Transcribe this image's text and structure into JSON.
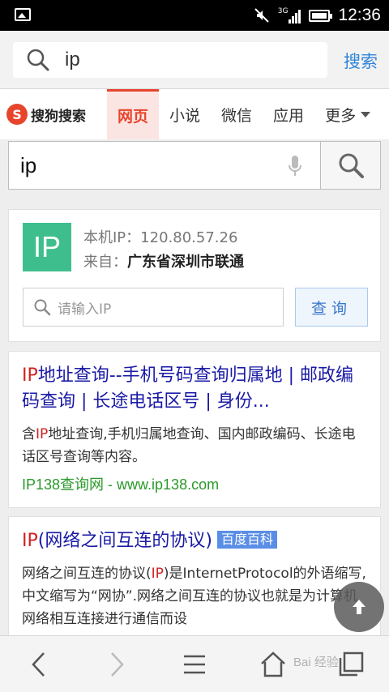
{
  "status_bar": {
    "time": "12:36",
    "network": "3G"
  },
  "url_bar": {
    "query": "ip",
    "search_label": "搜索"
  },
  "tabs": {
    "logo_mark": "S",
    "logo_text": "搜狗搜索",
    "items": [
      {
        "label": "网页",
        "active": true
      },
      {
        "label": "小说",
        "active": false
      },
      {
        "label": "微信",
        "active": false
      },
      {
        "label": "应用",
        "active": false
      },
      {
        "label": "更多",
        "active": false
      }
    ]
  },
  "search": {
    "value": "ip"
  },
  "ip_card": {
    "logo_text": "IP",
    "local_ip_label": "本机IP：",
    "local_ip": "120.80.57.26",
    "from_label": "来自：",
    "location": "广东省深圳市联通",
    "input_placeholder": "请输入IP",
    "query_button": "查询"
  },
  "results": [
    {
      "title_highlight": "IP",
      "title_rest": "地址查询--手机号码查询归属地 | 邮政编码查询 | 长途电话区号 | 身份...",
      "desc_pre": "含",
      "desc_highlight": "IP",
      "desc_post": "地址查询,手机归属地查询、国内邮政编码、长途电话区号查询等内容。",
      "url": "IP138查询网 - www.ip138.com"
    },
    {
      "title_highlight": "IP",
      "title_rest": "(网络之间互连的协议)",
      "badge": "百度百科",
      "desc_pre": "网络之间互连的协议(",
      "desc_highlight": "IP",
      "desc_post": ")是InternetProtocol的外语缩写,中文缩写为“网协”.网络之间互连的协议也就是为计算机网络相互连接进行通信而设"
    }
  ],
  "watermark": "Bai 经验",
  "colors": {
    "accent_red": "#e6452c",
    "link_blue": "#1a1aa6",
    "url_green": "#2a9a2a",
    "ip_green": "#3fbe8d"
  }
}
